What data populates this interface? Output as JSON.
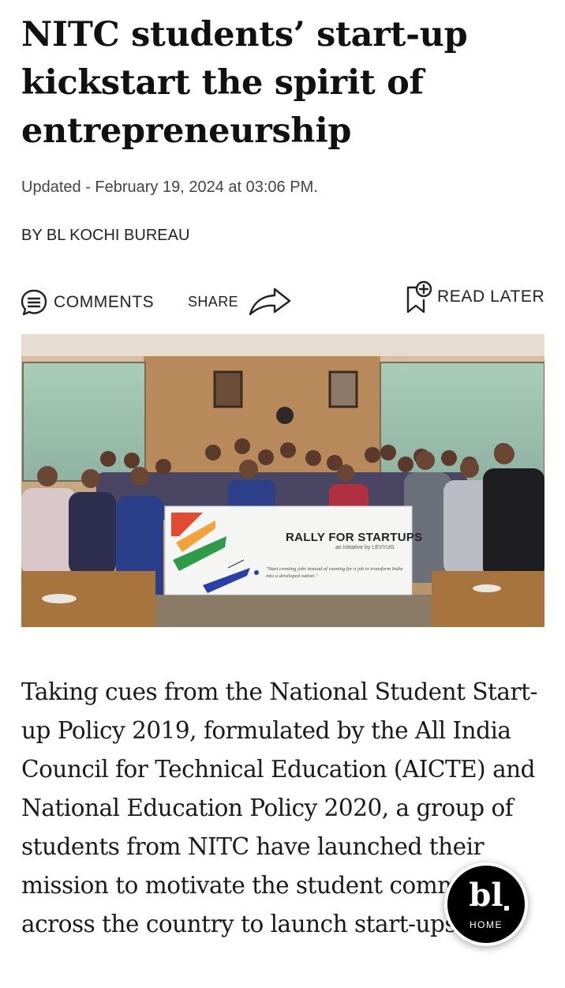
{
  "article": {
    "headline": "NITC students’ start-up kickstart the spirit of entrepreneurship",
    "updated": "Updated - February 19, 2024 at 03:06 PM.",
    "byline": "BY BL KOCHI BUREAU",
    "body": "Taking cues from the National Student Start-up Policy 2019, formulated by the All India Council for Technical Education (AICTE) and National Education Policy 2020, a group of students from NITC have launched their mission to motivate the student community across the country to launch start-ups."
  },
  "actions": {
    "comments_label": "COMMENTS",
    "comments_icon": "comment-bubble-icon",
    "share_label": "SHARE",
    "share_icon": "share-arrow-icon",
    "read_later_label": "READ LATER",
    "read_later_icon": "bookmark-plus-icon"
  },
  "photo": {
    "banner_title": "RALLY FOR STARTUPS",
    "banner_subtitle": "an initiative by LEVYUG",
    "banner_quote": "\"Start creating jobs instead of running for a job to transform India into a developed nation.\""
  },
  "home_button": {
    "logo": "bl",
    "label": "HOME"
  },
  "colors": {
    "text": "#111111",
    "meta": "#444444",
    "badge_bg": "#000000"
  }
}
